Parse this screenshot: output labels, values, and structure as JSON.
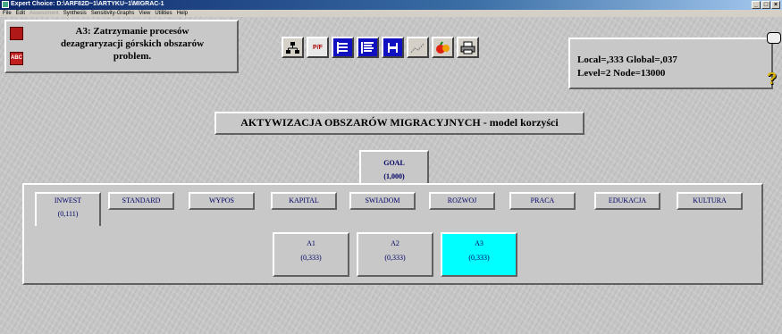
{
  "window": {
    "title": "Expert Choice: D:\\ARF82D~1\\ARTYKU~1\\MIGRAC-1",
    "controls": [
      "_",
      "□",
      "×"
    ]
  },
  "menu": {
    "file": "File",
    "edit": "Edit",
    "assessment": "Assessment",
    "synthesis": "Synthesis",
    "sensitivity": "Sensitivity-Graphs",
    "view": "View",
    "utilities": "Utilities",
    "help": "Help"
  },
  "node_panel": {
    "line1": "A3: Zatrzymanie procesów",
    "line2": "dezagraryzacji górskich obszarów",
    "line3": "problem.",
    "abc_icon": "ABC"
  },
  "toolbar": {
    "icons": [
      "hierarchy-icon",
      "pf-icon",
      "tree-icon",
      "list-icon",
      "save-icon",
      "graph-icon",
      "fruit-icon",
      "print-icon"
    ],
    "pf_label": "P/F"
  },
  "info": {
    "line1": "Local=,333 Global=,037",
    "line2": "Level=2 Node=13000"
  },
  "model_title": "AKTYWIZACJA OBSZARÓW MIGRACYJNYCH - model korzyści",
  "goal": {
    "label": "GOAL",
    "value": "(1,000)"
  },
  "criteria": [
    {
      "label": "INWEST",
      "value": "(0,111)"
    },
    {
      "label": "STANDARD"
    },
    {
      "label": "WYPOS"
    },
    {
      "label": "KAPITAL"
    },
    {
      "label": "SWIADOM"
    },
    {
      "label": "ROZWOJ"
    },
    {
      "label": "PRACA"
    },
    {
      "label": "EDUKACJA"
    },
    {
      "label": "KULTURA"
    }
  ],
  "alternatives": [
    {
      "label": "A1",
      "value": "(0,333)"
    },
    {
      "label": "A2",
      "value": "(0,333)"
    },
    {
      "label": "A3",
      "value": "(0,333)"
    }
  ],
  "colors": {
    "selected": "#00ffff",
    "node_text": "#000066",
    "titlebar": "#0a246a"
  }
}
